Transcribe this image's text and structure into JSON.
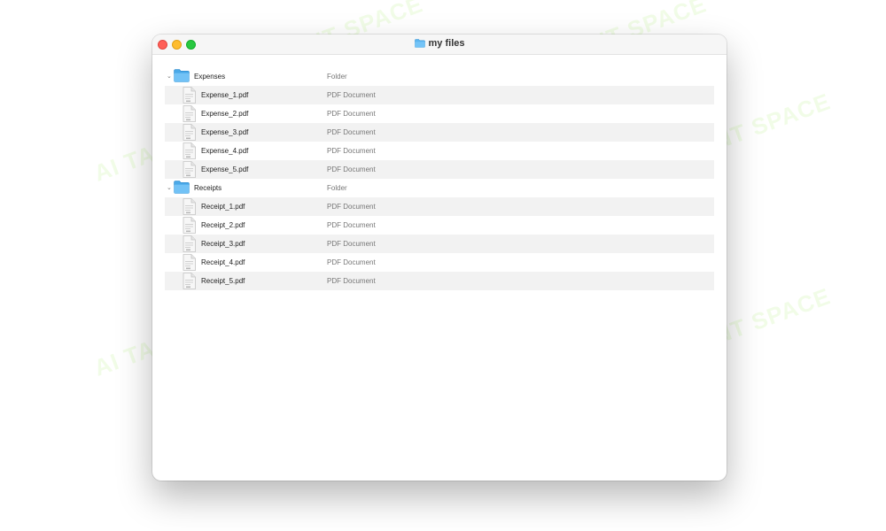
{
  "window": {
    "title": "my files"
  },
  "folders": [
    {
      "name": "Expenses",
      "kind": "Folder",
      "files": [
        {
          "name": "Expense_1.pdf",
          "kind": "PDF Document"
        },
        {
          "name": "Expense_2.pdf",
          "kind": "PDF Document"
        },
        {
          "name": "Expense_3.pdf",
          "kind": "PDF Document"
        },
        {
          "name": "Expense_4.pdf",
          "kind": "PDF Document"
        },
        {
          "name": "Expense_5.pdf",
          "kind": "PDF Document"
        }
      ]
    },
    {
      "name": "Receipts",
      "kind": "Folder",
      "files": [
        {
          "name": "Receipt_1.pdf",
          "kind": "PDF Document"
        },
        {
          "name": "Receipt_2.pdf",
          "kind": "PDF Document"
        },
        {
          "name": "Receipt_3.pdf",
          "kind": "PDF Document"
        },
        {
          "name": "Receipt_4.pdf",
          "kind": "PDF Document"
        },
        {
          "name": "Receipt_5.pdf",
          "kind": "PDF Document"
        }
      ]
    }
  ],
  "watermark": {
    "text": "AI TALENT SPACE"
  },
  "colors": {
    "folder": "#5bb5f0",
    "close": "#ff5f57",
    "minimize": "#febc2e",
    "maximize": "#28c840",
    "row_alt": "#f2f2f2"
  },
  "icons": {
    "chevron": "chevron-down-icon",
    "folder": "folder-icon",
    "file": "pdf-file-icon"
  }
}
